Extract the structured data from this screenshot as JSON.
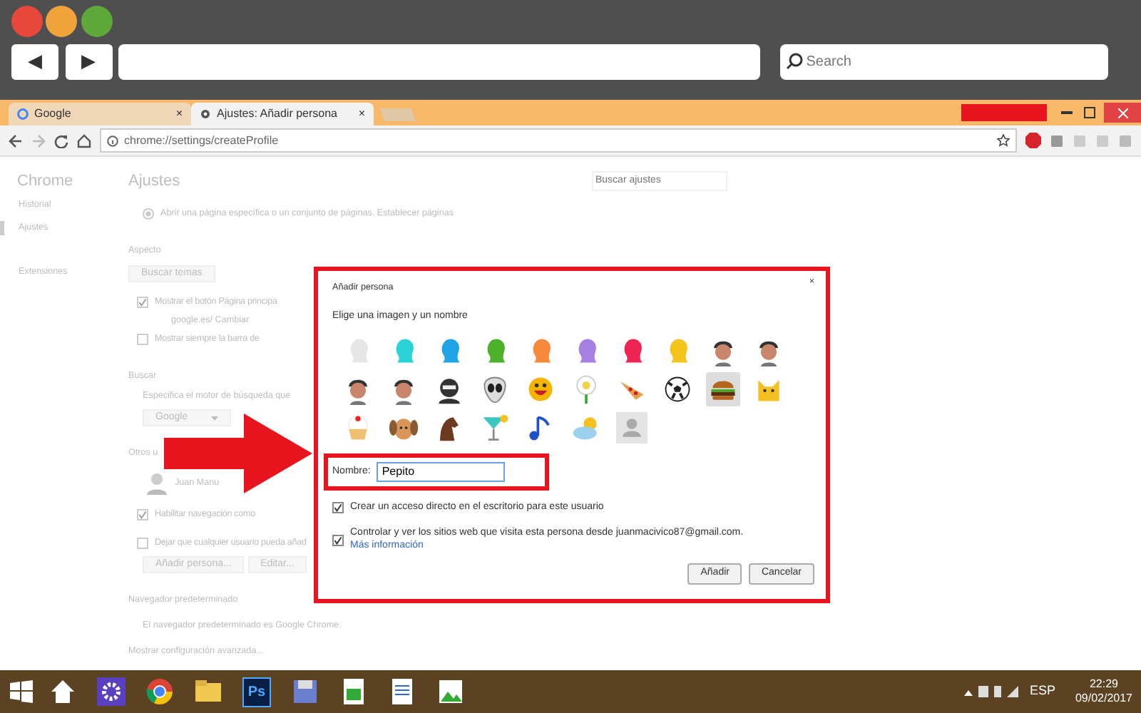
{
  "frame": {
    "back": "◀",
    "forward": "▶",
    "search_placeholder": "Search"
  },
  "tabs": [
    {
      "title": "Google",
      "close": "×",
      "selected": false
    },
    {
      "title": "Ajustes: Añadir persona",
      "close": "×",
      "selected": true
    }
  ],
  "address": "chrome://settings/createProfile",
  "sidebar": {
    "title": "Chrome",
    "items": [
      {
        "label": "Historial",
        "selected": false
      },
      {
        "label": "Ajustes",
        "selected": true
      },
      {
        "label": "Extensiones",
        "selected": false
      }
    ]
  },
  "settings": {
    "title": "Ajustes",
    "search_placeholder": "Buscar ajustes",
    "startup": "Abrir una página específica o un conjunto de páginas. Establecer páginas",
    "appearance": {
      "heading": "Aspecto",
      "button": "Buscar temas",
      "home_button": {
        "label": "Mostrar el botón Página principa",
        "checked": true
      },
      "home_url": "google.es/ Cambiar",
      "bookmarks_bar": {
        "label": "Mostrar siempre la barra de",
        "checked": false
      }
    },
    "search": {
      "heading": "Buscar",
      "text": "Especifica el motor de búsqueda que",
      "engine": "Google"
    },
    "users": {
      "heading": "Otros u",
      "current": "Juan Manu",
      "guest": {
        "label": "Habilitar navegación como",
        "checked": true
      },
      "anyone": {
        "label": "Dejar que cualquier usuario pueda añad",
        "checked": false
      },
      "add_button": "Añadir persona...",
      "edit_button": "Editar..."
    },
    "default_browser": {
      "heading": "Navegador predeterminado",
      "text": "El navegador predeterminado es Google Chrome."
    },
    "advanced": "Mostrar configuración avanzada..."
  },
  "dialog": {
    "title": "Añadir persona",
    "close": "×",
    "subtitle": "Elige una imagen y un nombre",
    "avatars": [
      {
        "kind": "head",
        "color": "#e6e6e6",
        "selected": false
      },
      {
        "kind": "head",
        "color": "#2ad3d6",
        "selected": false
      },
      {
        "kind": "head",
        "color": "#1ea3e6",
        "selected": false
      },
      {
        "kind": "head",
        "color": "#4cb12a",
        "selected": false
      },
      {
        "kind": "head",
        "color": "#f7893a",
        "selected": false
      },
      {
        "kind": "head",
        "color": "#a77ee2",
        "selected": false
      },
      {
        "kind": "head",
        "color": "#ef2452",
        "selected": false
      },
      {
        "kind": "head",
        "color": "#f3c41d",
        "selected": false
      },
      {
        "kind": "face",
        "selected": false
      },
      {
        "kind": "face",
        "selected": false
      },
      {
        "kind": "face",
        "selected": false
      },
      {
        "kind": "face",
        "selected": false
      },
      {
        "kind": "ninja",
        "selected": false
      },
      {
        "kind": "alien",
        "selected": false
      },
      {
        "kind": "smiley",
        "selected": false
      },
      {
        "kind": "flower",
        "selected": false
      },
      {
        "kind": "pizza",
        "selected": false
      },
      {
        "kind": "ball",
        "selected": false
      },
      {
        "kind": "burger",
        "selected": true
      },
      {
        "kind": "cat",
        "selected": false
      },
      {
        "kind": "cupcake",
        "selected": false
      },
      {
        "kind": "dog",
        "selected": false
      },
      {
        "kind": "horse",
        "selected": false
      },
      {
        "kind": "cocktail",
        "selected": false
      },
      {
        "kind": "music",
        "selected": false
      },
      {
        "kind": "cloud",
        "selected": false
      },
      {
        "kind": "person",
        "selected": false
      }
    ],
    "name_label": "Nombre:",
    "name_value": "Pepito",
    "options": [
      {
        "label": "Crear un acceso directo en el escritorio para este usuario",
        "checked": true
      },
      {
        "label": "Controlar y ver los sitios web que visita esta persona desde juanmacivico87@gmail.com.",
        "link": "Más información",
        "checked": true
      }
    ],
    "buttons": [
      "Añadir",
      "Cancelar"
    ]
  },
  "taskbar": {
    "apps": [
      {
        "kind": "home"
      },
      {
        "kind": "gear"
      },
      {
        "kind": "browser"
      },
      {
        "kind": "folder"
      },
      {
        "kind": "text",
        "label": "Ps"
      },
      {
        "kind": "disk"
      },
      {
        "kind": "sheet"
      },
      {
        "kind": "doc"
      },
      {
        "kind": "image"
      }
    ],
    "language": "ESP",
    "time": "22:29",
    "date": "09/02/2017"
  }
}
